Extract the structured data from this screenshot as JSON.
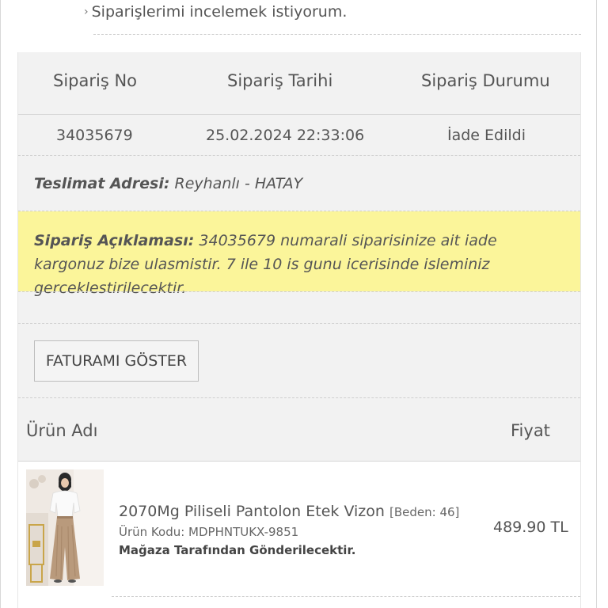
{
  "top": {
    "question": "Siparişlerimi incelemek istiyorum."
  },
  "order_table": {
    "headers": [
      "Sipariş No",
      "Sipariş Tarihi",
      "Sipariş Durumu"
    ],
    "order_no": "34035679",
    "order_date": "25.02.2024 22:33:06",
    "order_status": "İade Edildi"
  },
  "address": {
    "label": "Teslimat Adresi:",
    "value": "Reyhanlı - HATAY"
  },
  "note": {
    "label": "Sipariş Açıklaması:",
    "text": "34035679 numarali siparisinize ait iade kargonuz bize ulasmistir. 7 ile 10 is gunu icerisinde isleminiz gerceklestirilecektir.",
    "background": "#fbf59a"
  },
  "invoice_button": {
    "label": "FATURAMI GÖSTER"
  },
  "products": {
    "headers": {
      "name": "Ürün Adı",
      "price": "Fiyat"
    },
    "items": [
      {
        "title": "2070Mg Piliseli Pantolon Etek Vizon",
        "size_text": "[Beden: 46]",
        "code": "Ürün Kodu: MDPHNTUKX-9851",
        "shipping": "Mağaza Tarafından Gönderilecektir.",
        "price": "489.90 TL"
      }
    ]
  }
}
